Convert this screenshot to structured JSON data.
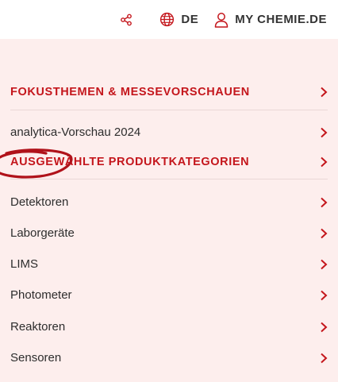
{
  "header": {
    "language": "DE",
    "account": "MY CHEMIE.DE"
  },
  "menu": {
    "section1": "FOKUSTHEMEN & MESSEVORSCHAUEN",
    "item1": "analytica-Vorschau 2024",
    "section2": "AUSGEWÄHLTE PRODUKTKATEGORIEN",
    "items": [
      "Detektoren",
      "Laborgeräte",
      "LIMS",
      "Photometer",
      "Reaktoren",
      "Sensoren"
    ]
  },
  "colors": {
    "accent": "#c4161c",
    "background": "#fdeeed",
    "annotation": "#b0121a"
  },
  "icons": [
    "share-icon",
    "globe-icon",
    "user-icon",
    "chevron-right-icon"
  ]
}
